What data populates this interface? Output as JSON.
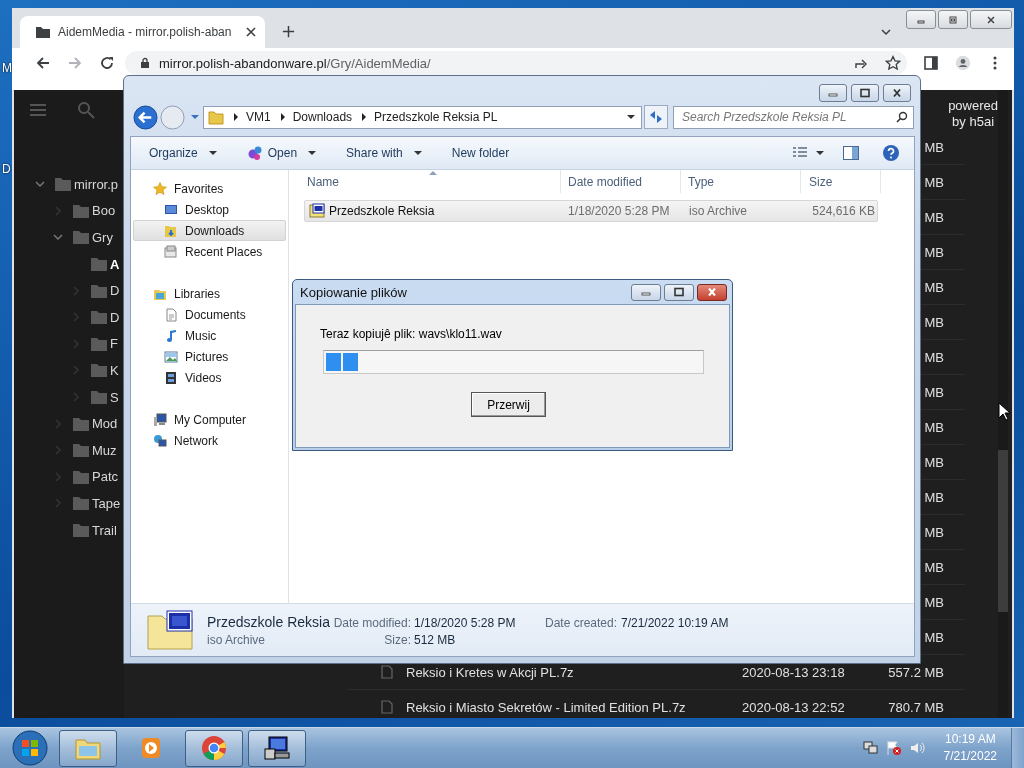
{
  "desktop": {
    "icon_labels": [
      "M",
      "D"
    ]
  },
  "browser": {
    "tab": {
      "title": "AidemMedia - mirror.polish-aban",
      "selected": true
    },
    "url": {
      "host": "mirror.polish-abandonware.pl",
      "path": "/Gry/AidemMedia/"
    },
    "tree": [
      {
        "label": "mirror.p",
        "expanded": true,
        "selected": false,
        "children": [
          {
            "label": "Boo",
            "expanded": false,
            "selected": false
          },
          {
            "label": "Gry",
            "expanded": true,
            "selected": false,
            "children": [
              {
                "label": "A",
                "selected": true
              },
              {
                "label": "D",
                "expanded": false,
                "selected": false
              },
              {
                "label": "D",
                "expanded": false,
                "selected": false
              },
              {
                "label": "F",
                "expanded": false,
                "selected": false
              },
              {
                "label": "K",
                "expanded": false,
                "selected": false
              },
              {
                "label": "S",
                "expanded": false,
                "selected": false
              }
            ]
          },
          {
            "label": "Mod",
            "expanded": false,
            "selected": false
          },
          {
            "label": "Muz",
            "expanded": false,
            "selected": false
          },
          {
            "label": "Patc",
            "expanded": false,
            "selected": false
          },
          {
            "label": "Tape",
            "expanded": false,
            "selected": false
          },
          {
            "label": "Trail",
            "selected": false
          }
        ]
      }
    ],
    "powered_by": [
      "powered",
      "by h5ai"
    ],
    "listing": [
      {
        "size": "MB"
      },
      {
        "size": "MB"
      },
      {
        "size": "MB"
      },
      {
        "size": "MB"
      },
      {
        "size": "MB"
      },
      {
        "size": "MB"
      },
      {
        "size": "MB"
      },
      {
        "size": "MB"
      },
      {
        "size": "MB"
      },
      {
        "size": "MB"
      },
      {
        "size": "MB"
      },
      {
        "size": "MB"
      },
      {
        "size": "MB"
      },
      {
        "size": "MB"
      },
      {
        "size": "MB"
      },
      {
        "name": "Reksio i Kretes w Akcji PL.7z",
        "modified": "2020-08-13 23:18",
        "size": "557.2 MB"
      },
      {
        "name": "Reksio i Miasto Sekretów - Limited Edition PL.7z",
        "modified": "2020-08-13 22:52",
        "size": "780.7 MB"
      }
    ]
  },
  "explorer": {
    "breadcrumbs": [
      "VM1",
      "Downloads",
      "Przedszkole Reksia PL"
    ],
    "search": {
      "placeholder": "Search Przedszkole Reksia PL"
    },
    "commands": [
      {
        "label": "Organize",
        "kind": "plain",
        "dropdown": true
      },
      {
        "label": "Open",
        "kind": "open",
        "dropdown": true
      },
      {
        "label": "Share with",
        "kind": "plain",
        "dropdown": true
      },
      {
        "label": "New folder",
        "kind": "plain",
        "dropdown": false
      }
    ],
    "nav": [
      {
        "label": "Favorites",
        "kind": "favorites",
        "selected": false,
        "children": [
          {
            "label": "Desktop",
            "kind": "desktop",
            "selected": false
          },
          {
            "label": "Downloads",
            "kind": "downloads",
            "selected": true
          },
          {
            "label": "Recent Places",
            "kind": "recent",
            "selected": false
          }
        ]
      },
      {
        "label": "Libraries",
        "kind": "libraries",
        "selected": false,
        "children": [
          {
            "label": "Documents",
            "kind": "documents",
            "selected": false
          },
          {
            "label": "Music",
            "kind": "music",
            "selected": false
          },
          {
            "label": "Pictures",
            "kind": "pictures",
            "selected": false
          },
          {
            "label": "Videos",
            "kind": "videos",
            "selected": false
          }
        ]
      },
      {
        "label": "My Computer",
        "kind": "computer",
        "selected": false
      },
      {
        "label": "Network",
        "kind": "network",
        "selected": false
      }
    ],
    "columns": [
      "Name",
      "Date modified",
      "Type",
      "Size"
    ],
    "files": [
      {
        "name": "Przedszkole Reksia",
        "modified": "1/18/2020 5:28 PM",
        "type": "iso Archive",
        "size": "524,616 KB",
        "selected": true
      }
    ],
    "details": {
      "name": "Przedszkole Reksia",
      "type": "iso Archive",
      "fields": [
        {
          "label": "Date modified:",
          "value": "1/18/2020 5:28 PM"
        },
        {
          "label": "Size:",
          "value": "512 MB"
        },
        {
          "label": "Date created:",
          "value": "7/21/2022 10:19 AM"
        }
      ]
    }
  },
  "dialog": {
    "title": "Kopiowanie plików",
    "message": "Teraz kopiujê plik: wavs\\klo11.wav",
    "progress": {
      "level": 0.085
    },
    "button": "Przerwij"
  },
  "taskbar": {
    "apps": [
      {
        "kind": "explorer",
        "running": true
      },
      {
        "kind": "media",
        "running": false
      },
      {
        "kind": "chrome",
        "running": true
      },
      {
        "kind": "setup",
        "running": true
      }
    ],
    "clock": {
      "time": "10:19 AM",
      "date": "7/21/2022"
    }
  }
}
